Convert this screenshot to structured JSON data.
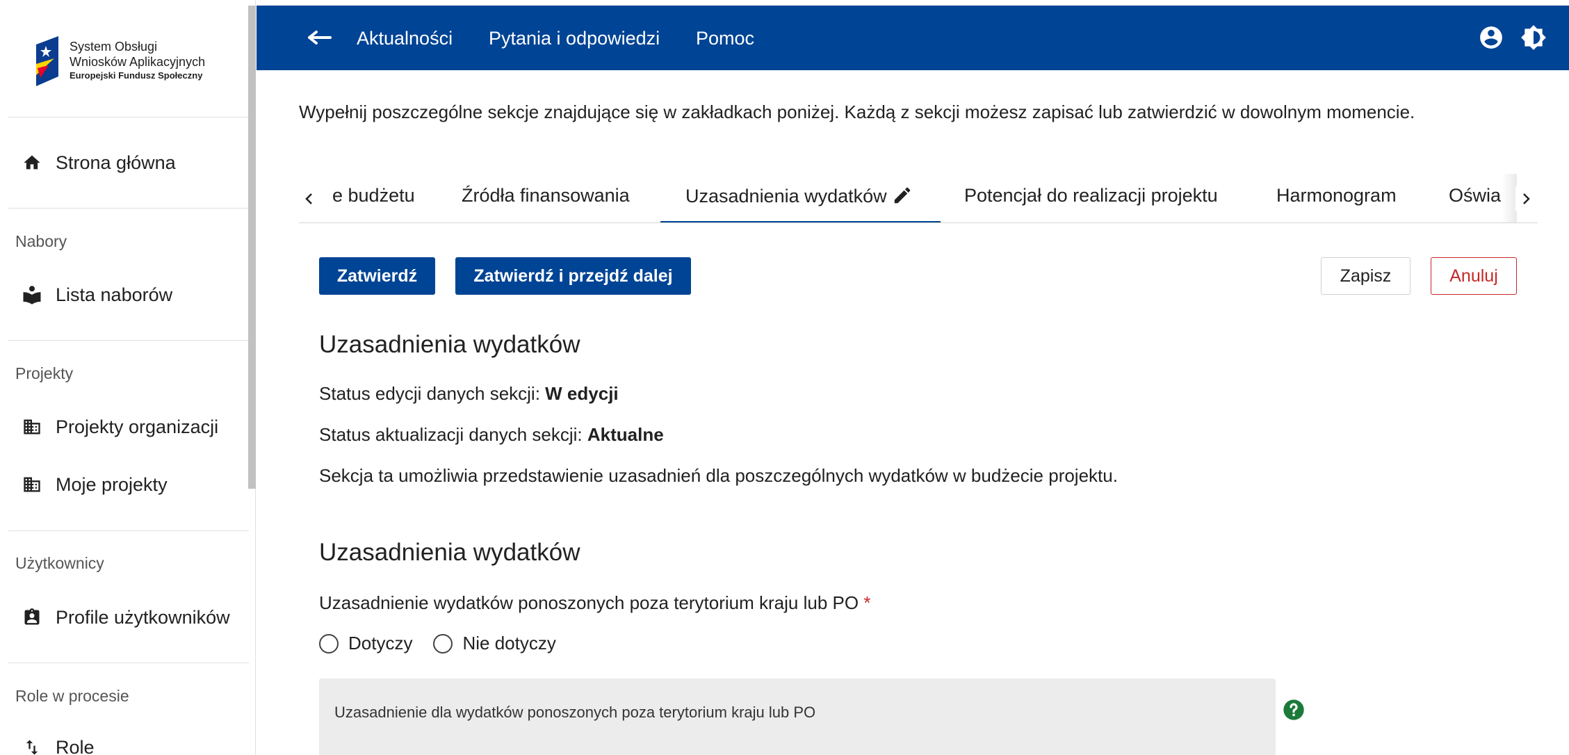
{
  "sidebar": {
    "logo": {
      "line1": "System Obsługi",
      "line2": "Wniosków Aplikacyjnych",
      "line3": "Europejski Fundusz Społeczny"
    },
    "home": "Strona główna",
    "sections": {
      "nabory": "Nabory",
      "projekty": "Projekty",
      "uzytkownicy": "Użytkownicy",
      "role_w_procesie": "Role w procesie"
    },
    "items": {
      "lista_naborow": "Lista naborów",
      "projekty_organizacji": "Projekty organizacji",
      "moje_projekty": "Moje projekty",
      "profile_uzytkownikow": "Profile użytkowników",
      "role": "Role"
    }
  },
  "topbar": {
    "links": [
      "Aktualności",
      "Pytania i odpowiedzi",
      "Pomoc"
    ],
    "color": "#004495"
  },
  "main": {
    "intro": "Wypełnij poszczególne sekcje znajdujące się w zakładkach poniżej. Każdą z sekcji możesz zapisać lub zatwierdzić w dowolnym momencie.",
    "tabs": [
      "e budżetu",
      "Źródła finansowania",
      "Uzasadnienia wydatków",
      "Potencjał do realizacji projektu",
      "Harmonogram",
      "Oświa"
    ],
    "active_tab": "Uzasadnienia wydatków",
    "buttons": {
      "zatwierdz": "Zatwierdź",
      "zatwierdz_dalej": "Zatwierdź i przejdź dalej",
      "zapisz": "Zapisz",
      "anuluj": "Anuluj"
    },
    "section_title": "Uzasadnienia wydatków",
    "status_edycji_label": "Status edycji danych sekcji:",
    "status_edycji_value": "W edycji",
    "status_aktualizacji_label": "Status aktualizacji danych sekcji:",
    "status_aktualizacji_value": "Aktualne",
    "description": "Sekcja ta umożliwia przedstawienie uzasadnień dla poszczególnych wydatków w budżecie projektu.",
    "subsection_title": "Uzasadnienia wydatków",
    "question_label": "Uzasadnienie wydatków ponoszonych poza terytorium kraju lub PO",
    "required_mark": "*",
    "radio_options": [
      "Dotyczy",
      "Nie dotyczy"
    ],
    "textarea_label": "Uzasadnienie dla wydatków ponoszonych poza terytorium kraju lub PO"
  }
}
